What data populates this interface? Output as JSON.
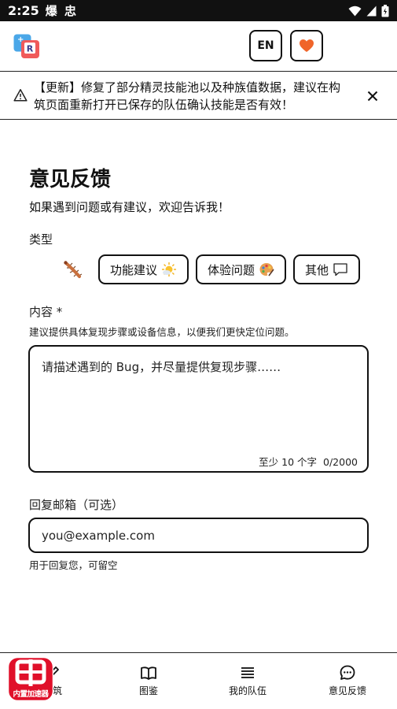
{
  "statusbar": {
    "time": "2:25",
    "notifications": "爆 忠"
  },
  "header": {
    "lang_label": "EN"
  },
  "notice": {
    "text": "【更新】修复了部分精灵技能池以及种族值数据，建议在构筑页面重新打开已保存的队伍确认技能是否有效！"
  },
  "page": {
    "title": "意见反馈",
    "subtitle": "如果遇到问题或有建议，欢迎告诉我！",
    "type_label": "类型",
    "types": [
      {
        "label": "功能建议",
        "icon": "sun-icon"
      },
      {
        "label": "体验问题",
        "icon": "palette-icon"
      },
      {
        "label": "其他",
        "icon": "chat-bubble-icon"
      }
    ],
    "content_label": "内容 *",
    "content_hint": "建议提供具体复现步骤或设备信息，以便我们更快定位问题。",
    "content_placeholder": "请描述遇到的 Bug，并尽量提供复现步骤……",
    "content_min": "至少 10 个字",
    "content_count": "0/2000",
    "email_label": "回复邮箱（可选）",
    "email_placeholder": "you@example.com",
    "email_hint": "用于回复您，可留空"
  },
  "nav": {
    "items": [
      {
        "label": "构筑",
        "icon": "pen-icon"
      },
      {
        "label": "图鉴",
        "icon": "book-icon"
      },
      {
        "label": "我的队伍",
        "icon": "list-icon"
      },
      {
        "label": "意见反馈",
        "icon": "feedback-icon"
      }
    ]
  },
  "overlay": {
    "badge_text": "内置加速器"
  },
  "colors": {
    "accent": "#f0652a",
    "border": "#111111",
    "overlay_red": "#e0102a"
  }
}
